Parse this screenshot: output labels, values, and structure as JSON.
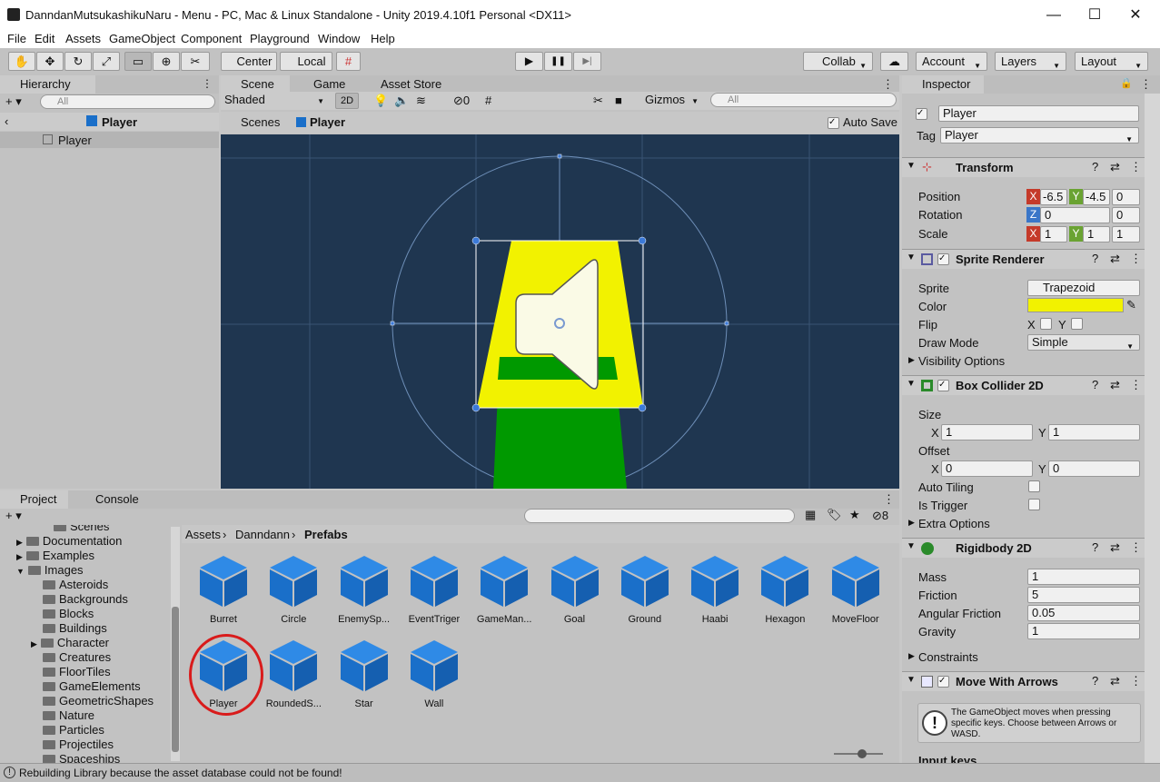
{
  "window": {
    "title": "DanndanMutsukashikuNaru - Menu - PC, Mac & Linux Standalone - Unity 2019.4.10f1 Personal <DX11>",
    "min": "—",
    "max": "☐",
    "close": "✕"
  },
  "menu": [
    "File",
    "Edit",
    "Assets",
    "GameObject",
    "Component",
    "Playground",
    "Window",
    "Help"
  ],
  "toolbar": {
    "pivot": "Center",
    "space": "Local",
    "collab": "Collab",
    "account": "Account",
    "layers": "Layers",
    "layout": "Layout",
    "play": "▶",
    "pause": "❚❚",
    "step": "▶|"
  },
  "hierarchy": {
    "tab": "Hierarchy",
    "search_placeholder": "All",
    "add": "+ ▾",
    "header": "Player",
    "item": "Player"
  },
  "scene": {
    "tabs": [
      "Scene",
      "Game",
      "Asset Store"
    ],
    "shading": "Shaded",
    "mode2d": "2D",
    "hidden_count": "0",
    "gizmos": "Gizmos",
    "search_placeholder": "All",
    "breadcrumb_root": "Scenes",
    "breadcrumb_obj": "Player",
    "auto_save": "Auto Save"
  },
  "project": {
    "tabs": [
      "Project",
      "Console"
    ],
    "hidden_count": "8",
    "breadcrumb": [
      "Assets",
      "Danndann",
      "Prefabs"
    ],
    "tree": [
      {
        "label": "Scenes",
        "expand": ""
      },
      {
        "label": "Documentation",
        "expand": "▶"
      },
      {
        "label": "Examples",
        "expand": "▶"
      },
      {
        "label": "Images",
        "expand": "▼"
      },
      {
        "label": "Asteroids",
        "expand": ""
      },
      {
        "label": "Backgrounds",
        "expand": ""
      },
      {
        "label": "Blocks",
        "expand": ""
      },
      {
        "label": "Buildings",
        "expand": ""
      },
      {
        "label": "Character",
        "expand": "▶"
      },
      {
        "label": "Creatures",
        "expand": ""
      },
      {
        "label": "FloorTiles",
        "expand": ""
      },
      {
        "label": "GameElements",
        "expand": ""
      },
      {
        "label": "GeometricShapes",
        "expand": ""
      },
      {
        "label": "Nature",
        "expand": ""
      },
      {
        "label": "Particles",
        "expand": ""
      },
      {
        "label": "Projectiles",
        "expand": ""
      },
      {
        "label": "Spaceships",
        "expand": ""
      }
    ],
    "assets": [
      "Burret",
      "Circle",
      "EnemySp...",
      "EventTriger",
      "GameMan...",
      "Goal",
      "Ground",
      "Haabi",
      "Hexagon",
      "MoveFloor",
      "Player",
      "RoundedS...",
      "Star",
      "Wall"
    ],
    "highlighted": "Player"
  },
  "inspector": {
    "tab": "Inspector",
    "name": "Player",
    "tag_label": "Tag",
    "tag": "Player",
    "transform": {
      "title": "Transform",
      "position_label": "Position",
      "rotation_label": "Rotation",
      "scale_label": "Scale",
      "pos_x": "-6.5",
      "pos_y": "-4.5",
      "pos_z": "0",
      "rot_z": "0",
      "rot_val": "0",
      "scale_x": "1",
      "scale_y": "1",
      "scale_z": "1"
    },
    "sprite_renderer": {
      "title": "Sprite Renderer",
      "sprite_label": "Sprite",
      "sprite": "Trapezoid",
      "color_label": "Color",
      "color": "#f2f200",
      "flip_label": "Flip",
      "flip_x": "X",
      "flip_y": "Y",
      "draw_mode_label": "Draw Mode",
      "draw_mode": "Simple",
      "visibility": "Visibility Options"
    },
    "box_collider": {
      "title": "Box Collider 2D",
      "size_label": "Size",
      "size_x": "1",
      "size_y": "1",
      "offset_label": "Offset",
      "offset_x": "0",
      "offset_y": "0",
      "auto_tiling": "Auto Tiling",
      "is_trigger": "Is Trigger",
      "extra": "Extra Options"
    },
    "rigidbody": {
      "title": "Rigidbody 2D",
      "mass_label": "Mass",
      "mass": "1",
      "friction_label": "Friction",
      "friction": "5",
      "angular_label": "Angular Friction",
      "angular": "0.05",
      "gravity_label": "Gravity",
      "gravity": "1",
      "constraints": "Constraints"
    },
    "move_arrows": {
      "title": "Move With Arrows",
      "help": "The GameObject moves when pressing specific keys. Choose between Arrows or WASD.",
      "input_keys": "Input keys"
    },
    "axis_x": "X",
    "axis_y": "Y",
    "axis_z": "Z"
  },
  "status": {
    "text": "Rebuilding Library because the asset database could not be found!"
  },
  "colors": {
    "accent": "#1a6fc9",
    "scene_bg": "#1f3650",
    "yellow": "#f2f200",
    "green": "#009900"
  }
}
